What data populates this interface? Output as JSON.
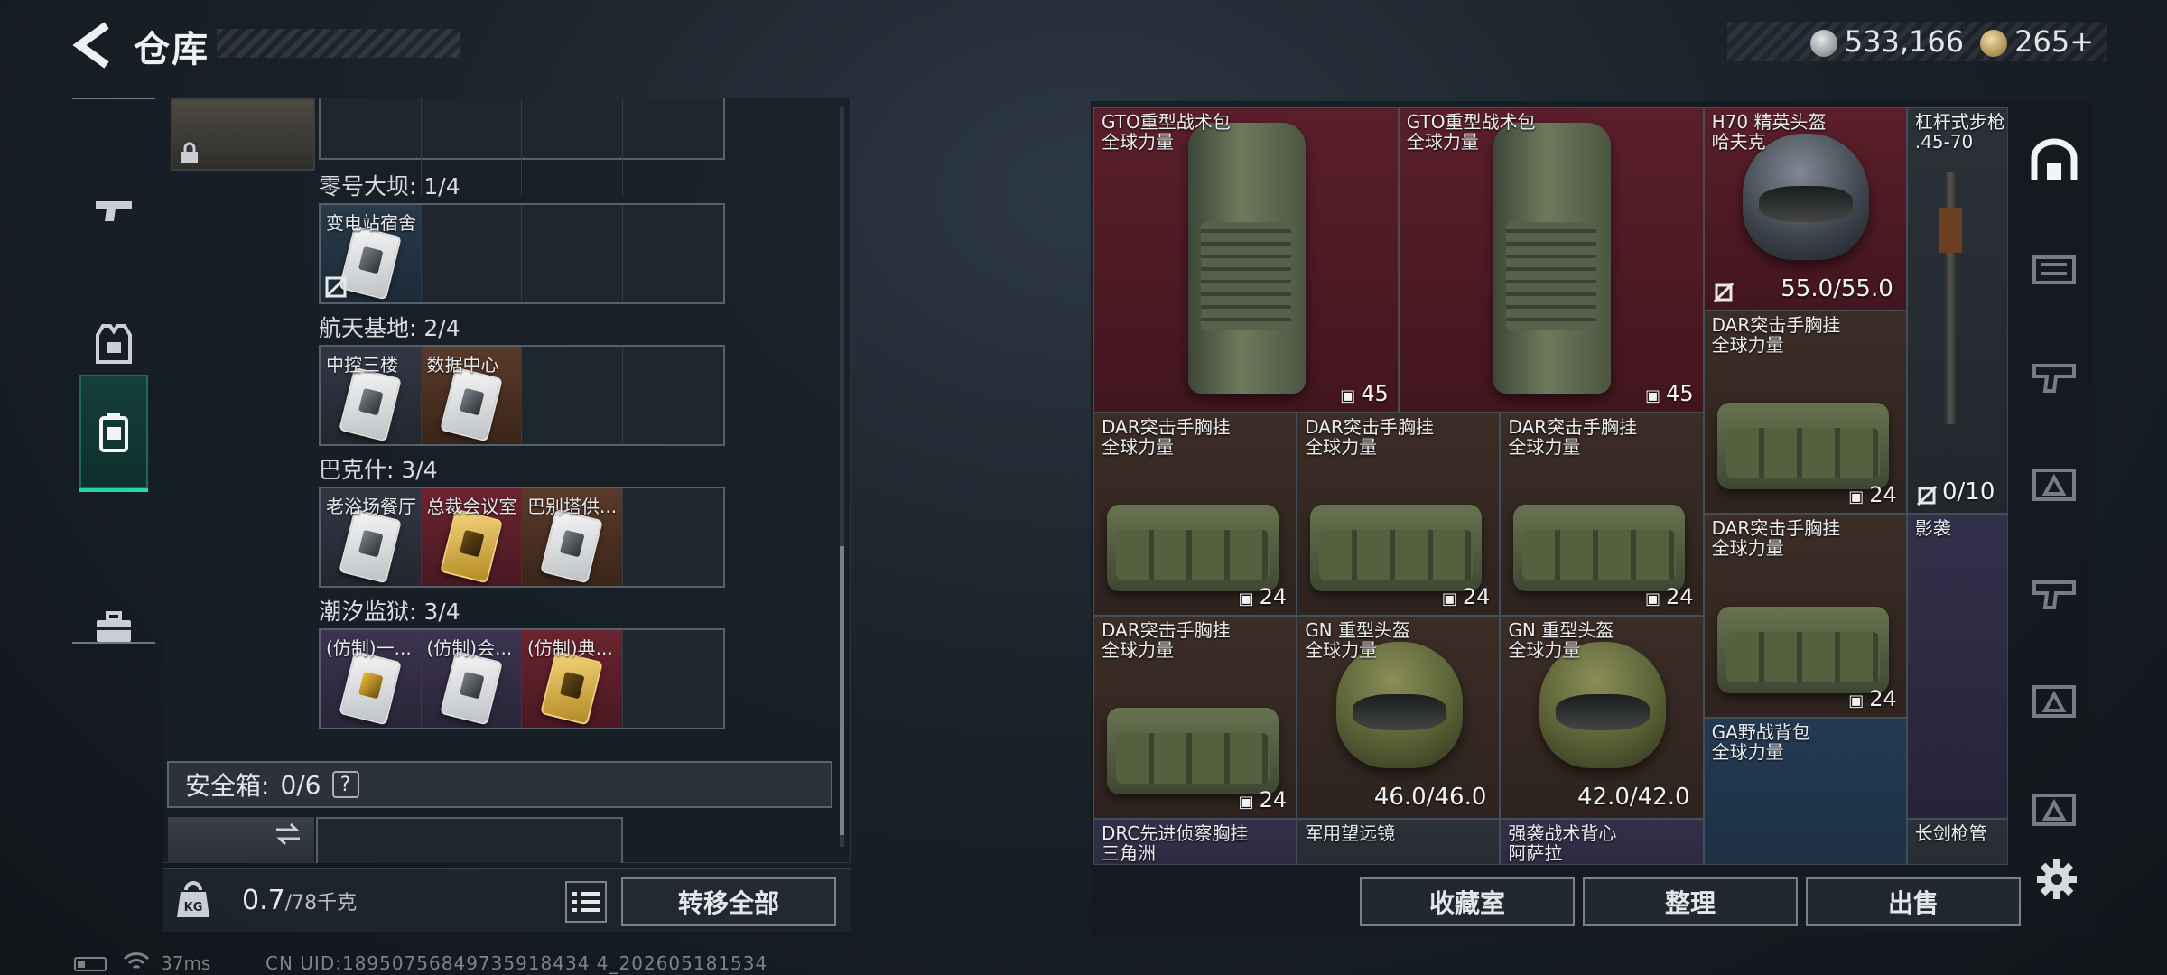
{
  "header": {
    "title": "仓库",
    "currency_silver": "533,166",
    "currency_gold": "265",
    "plus": "+"
  },
  "tabs": [
    {
      "name": "weapons-tab-icon",
      "active": false
    },
    {
      "name": "armor-tab-icon",
      "active": false
    },
    {
      "name": "keys-tab-icon",
      "active": true
    },
    {
      "name": "toolbox-tab-icon",
      "active": false
    }
  ],
  "key_rooms": [
    {
      "label": "零号大坝: 1/4",
      "slots": [
        {
          "name": "变电站宿舍",
          "bg": "blue",
          "locked": true,
          "card": "white"
        }
      ]
    },
    {
      "label": "航天基地: 2/4",
      "slots": [
        {
          "name": "中控三楼",
          "bg": "grey",
          "card": "white"
        },
        {
          "name": "数据中心",
          "bg": "brown",
          "card": "white"
        }
      ]
    },
    {
      "label": "巴克什: 3/4",
      "slots": [
        {
          "name": "老浴场餐厅",
          "bg": "grey",
          "card": "white"
        },
        {
          "name": "总裁会议室",
          "bg": "red",
          "card": "gold"
        },
        {
          "name": "巴别塔供...",
          "bg": "brown",
          "card": "white"
        }
      ]
    },
    {
      "label": "潮汐监狱: 3/4",
      "slots": [
        {
          "name": "(仿制)一...",
          "bg": "purple",
          "card": "yellowmark"
        },
        {
          "name": "(仿制)会...",
          "bg": "purple",
          "card": "white"
        },
        {
          "name": "(仿制)典...",
          "bg": "red",
          "card": "gold"
        }
      ]
    }
  ],
  "safe_box": {
    "label": "安全箱:",
    "value": "0/6",
    "help": "?"
  },
  "weight": {
    "current": "0.7",
    "max": "/78千克"
  },
  "buttons": {
    "transfer_all": "转移全部",
    "collection": "收藏室",
    "organize": "整理",
    "sell": "出售"
  },
  "status": {
    "ping": "37ms",
    "uid": "CN UID:18950756849735918434 4_202605181534"
  },
  "warehouse_items": [
    {
      "id": "gto1",
      "name": "GTO重型战术包\n全球力量",
      "count": "45",
      "color": "red",
      "art": "pack"
    },
    {
      "id": "gto2",
      "name": "GTO重型战术包\n全球力量",
      "count": "45",
      "color": "red",
      "art": "pack"
    },
    {
      "id": "h70",
      "name": "H70 精英头盔\n哈夫克",
      "durability": "55.0/55.0",
      "color": "red",
      "art": "helm dark"
    },
    {
      "id": "lever",
      "name": "杠杆式步枪\n.45-70",
      "durability": "0/10",
      "color": "slate",
      "art": "rifle"
    },
    {
      "id": "dar1",
      "name": "DAR突击手胸挂\n全球力量",
      "count": "24",
      "color": "brown",
      "art": "rig"
    },
    {
      "id": "dar2",
      "name": "DAR突击手胸挂\n全球力量",
      "count": "24",
      "color": "brown",
      "art": "rig"
    },
    {
      "id": "dar3",
      "name": "DAR突击手胸挂\n全球力量",
      "count": "24",
      "color": "brown",
      "art": "rig"
    },
    {
      "id": "dar4",
      "name": "DAR突击手胸挂\n全球力量",
      "count": "24",
      "color": "brown",
      "art": "rig"
    },
    {
      "id": "dar5",
      "name": "DAR突击手胸挂\n全球力量",
      "count": "24",
      "color": "brown",
      "art": "rig"
    },
    {
      "id": "dar6",
      "name": "DAR突击手胸挂\n全球力量",
      "count": "24",
      "color": "brown",
      "art": "rig"
    },
    {
      "id": "gn1",
      "name": "GN 重型头盔\n全球力量",
      "durability": "46.0/46.0",
      "color": "brown",
      "art": "helm green"
    },
    {
      "id": "gn2",
      "name": "GN 重型头盔\n全球力量",
      "durability": "42.0/42.0",
      "color": "brown",
      "art": "helm green"
    },
    {
      "id": "yingxi",
      "name": "影袭",
      "color": "purp",
      "art": ""
    },
    {
      "id": "ga",
      "name": "GA野战背包\n全球力量",
      "color": "blue",
      "art": ""
    },
    {
      "id": "drc",
      "name": "DRC先进侦察胸挂\n三角洲",
      "color": "purp",
      "art": ""
    },
    {
      "id": "scope",
      "name": "军用望远镜",
      "color": "slate",
      "art": ""
    },
    {
      "id": "vest",
      "name": "强袭战术背心\n阿萨拉",
      "color": "purp",
      "art": ""
    },
    {
      "id": "barrel",
      "name": "长剑枪管",
      "color": "slate",
      "art": ""
    }
  ]
}
